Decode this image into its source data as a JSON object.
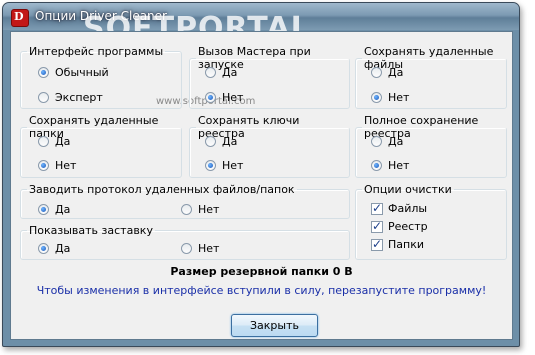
{
  "window": {
    "title": "Опции Driver Cleaner",
    "watermark": "SOFTPORTAL",
    "watermark_url": "www.softportal.com"
  },
  "groups": {
    "interface": {
      "label": "Интерфейс программы",
      "options": [
        "Обычный",
        "Эксперт"
      ],
      "selected": 0
    },
    "wizard": {
      "label": "Вызов Мастера при запуске",
      "options": [
        "Да",
        "Нет"
      ],
      "selected": 1
    },
    "save_files": {
      "label": "Сохранять удаленные файлы",
      "options": [
        "Да",
        "Нет"
      ],
      "selected": 1
    },
    "save_folders": {
      "label": "Сохранять удаленные папки",
      "options": [
        "Да",
        "Нет"
      ],
      "selected": 1
    },
    "save_keys": {
      "label": "Сохранять ключи реестра",
      "options": [
        "Да",
        "Нет"
      ],
      "selected": 1
    },
    "full_registry": {
      "label": "Полное сохранение реестра",
      "options": [
        "Да",
        "Нет"
      ],
      "selected": 1
    },
    "log": {
      "label": "Заводить протокол удаленных файлов/папок",
      "options": [
        "Да",
        "Нет"
      ],
      "selected": 0
    },
    "splash": {
      "label": "Показывать заставку",
      "options": [
        "Да",
        "Нет"
      ],
      "selected": 0
    },
    "clean": {
      "label": "Опции очистки",
      "items": [
        "Файлы",
        "Реестр",
        "Папки"
      ],
      "checked": [
        true,
        true,
        true
      ]
    }
  },
  "backup_size": "Размер резервной папки 0 B",
  "notice": "Чтобы изменения в интерфейсе вступили в силу, перезапустите программу!",
  "close_label": "Закрыть"
}
